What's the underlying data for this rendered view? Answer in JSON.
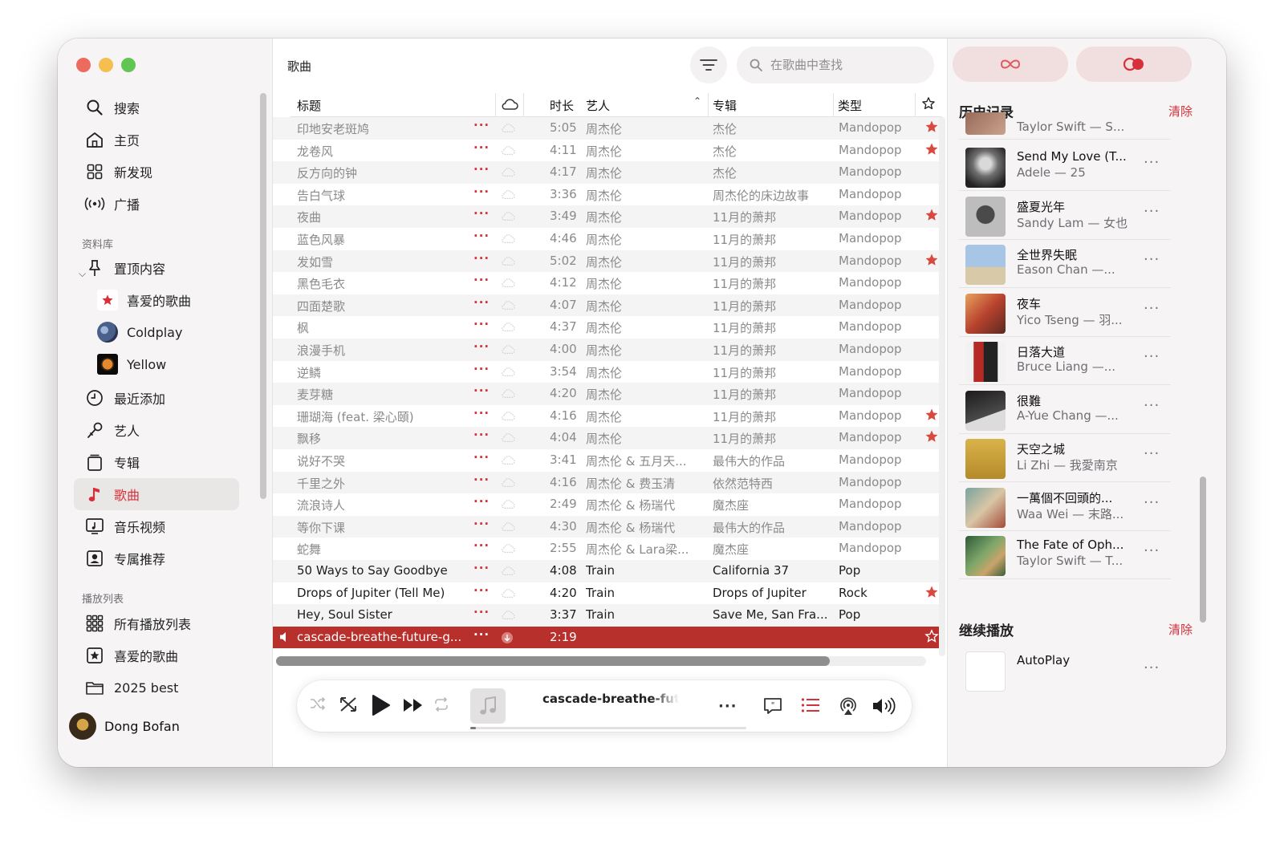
{
  "sidebar": {
    "nav": [
      "搜索",
      "主页",
      "新发现",
      "广播"
    ],
    "library_label": "资料库",
    "library": [
      "置顶内容",
      "喜爱的歌曲",
      "Coldplay",
      "Yellow",
      "最近添加",
      "艺人",
      "专辑",
      "歌曲",
      "音乐视频",
      "专属推荐"
    ],
    "playlists_label": "播放列表",
    "playlists": [
      "所有播放列表",
      "喜爱的歌曲",
      "2025 best"
    ],
    "user": "Dong Bofan"
  },
  "main": {
    "title": "歌曲",
    "search_placeholder": "在歌曲中查找",
    "columns": {
      "title": "标题",
      "duration": "时长",
      "artist": "艺人",
      "album": "专辑",
      "genre": "类型"
    },
    "rows": [
      {
        "title": "印地安老斑鸠",
        "time": "5:05",
        "artist": "周杰伦",
        "album": "杰伦",
        "genre": "Mandopop",
        "fav": true
      },
      {
        "title": "龙卷风",
        "time": "4:11",
        "artist": "周杰伦",
        "album": "杰伦",
        "genre": "Mandopop",
        "fav": true
      },
      {
        "title": "反方向的钟",
        "time": "4:17",
        "artist": "周杰伦",
        "album": "杰伦",
        "genre": "Mandopop",
        "fav": false
      },
      {
        "title": "告白气球",
        "time": "3:36",
        "artist": "周杰伦",
        "album": "周杰伦的床边故事",
        "genre": "Mandopop",
        "fav": false
      },
      {
        "title": "夜曲",
        "time": "3:49",
        "artist": "周杰伦",
        "album": "11月的萧邦",
        "genre": "Mandopop",
        "fav": true
      },
      {
        "title": "蓝色风暴",
        "time": "4:46",
        "artist": "周杰伦",
        "album": "11月的萧邦",
        "genre": "Mandopop",
        "fav": false
      },
      {
        "title": "发如雪",
        "time": "5:02",
        "artist": "周杰伦",
        "album": "11月的萧邦",
        "genre": "Mandopop",
        "fav": true
      },
      {
        "title": "黑色毛衣",
        "time": "4:12",
        "artist": "周杰伦",
        "album": "11月的萧邦",
        "genre": "Mandopop",
        "fav": false
      },
      {
        "title": "四面楚歌",
        "time": "4:07",
        "artist": "周杰伦",
        "album": "11月的萧邦",
        "genre": "Mandopop",
        "fav": false
      },
      {
        "title": "枫",
        "time": "4:37",
        "artist": "周杰伦",
        "album": "11月的萧邦",
        "genre": "Mandopop",
        "fav": false
      },
      {
        "title": "浪漫手机",
        "time": "4:00",
        "artist": "周杰伦",
        "album": "11月的萧邦",
        "genre": "Mandopop",
        "fav": false
      },
      {
        "title": "逆鳞",
        "time": "3:54",
        "artist": "周杰伦",
        "album": "11月的萧邦",
        "genre": "Mandopop",
        "fav": false
      },
      {
        "title": "麦芽糖",
        "time": "4:20",
        "artist": "周杰伦",
        "album": "11月的萧邦",
        "genre": "Mandopop",
        "fav": false
      },
      {
        "title": "珊瑚海 (feat. 梁心頤)",
        "time": "4:16",
        "artist": "周杰伦",
        "album": "11月的萧邦",
        "genre": "Mandopop",
        "fav": true
      },
      {
        "title": "飘移",
        "time": "4:04",
        "artist": "周杰伦",
        "album": "11月的萧邦",
        "genre": "Mandopop",
        "fav": true
      },
      {
        "title": "说好不哭",
        "time": "3:41",
        "artist": "周杰伦 & 五月天...",
        "album": "最伟大的作品",
        "genre": "Mandopop",
        "fav": false
      },
      {
        "title": "千里之外",
        "time": "4:16",
        "artist": "周杰伦 & 费玉清",
        "album": "依然范特西",
        "genre": "Mandopop",
        "fav": false
      },
      {
        "title": "流浪诗人",
        "time": "2:49",
        "artist": "周杰伦 & 杨瑞代",
        "album": "魔杰座",
        "genre": "Mandopop",
        "fav": false
      },
      {
        "title": "等你下课",
        "time": "4:30",
        "artist": "周杰伦 & 杨瑞代",
        "album": "最伟大的作品",
        "genre": "Mandopop",
        "fav": false
      },
      {
        "title": "蛇舞",
        "time": "2:55",
        "artist": "周杰伦 & Lara梁...",
        "album": "魔杰座",
        "genre": "Mandopop",
        "fav": false
      },
      {
        "title": "50 Ways to Say Goodbye",
        "time": "4:08",
        "artist": "Train",
        "album": "California 37",
        "genre": "Pop",
        "fav": false
      },
      {
        "title": "Drops of Jupiter (Tell Me)",
        "time": "4:20",
        "artist": "Train",
        "album": "Drops of Jupiter",
        "genre": "Rock",
        "fav": true
      },
      {
        "title": "Hey, Soul Sister",
        "time": "3:37",
        "artist": "Train",
        "album": "Save Me, San Fra...",
        "genre": "Pop",
        "fav": false
      },
      {
        "title": "cascade-breathe-future-g...",
        "time": "2:19",
        "artist": "",
        "album": "",
        "genre": "",
        "fav": false
      }
    ]
  },
  "player": {
    "now_playing": "cascade-breathe-future",
    "progress": 0.02
  },
  "right": {
    "history_label": "历史记录",
    "clear_label": "清除",
    "history_top_partial": "Taylor Swift — S...",
    "history": [
      {
        "title": "Send My Love (T...",
        "sub": "Adele — 25"
      },
      {
        "title": "盛夏光年",
        "sub": "Sandy Lam — 女也"
      },
      {
        "title": "全世界失眠",
        "sub": "Eason Chan —..."
      },
      {
        "title": "夜车",
        "sub": "Yico Tseng — 羽..."
      },
      {
        "title": "日落大道",
        "sub": "Bruce Liang —..."
      },
      {
        "title": "很難",
        "sub": "A-Yue Chang —..."
      },
      {
        "title": "天空之城",
        "sub": "Li Zhi — 我愛南京"
      },
      {
        "title": "一萬個不回頭的...",
        "sub": "Waa Wei — 末路..."
      },
      {
        "title": "The Fate of Oph...",
        "sub": "Taylor Swift — T..."
      }
    ],
    "continue_label": "继续播放",
    "autoplay": "AutoPlay"
  },
  "colors": {
    "accent": "#d7303a",
    "playing_row": "#b8302c"
  }
}
